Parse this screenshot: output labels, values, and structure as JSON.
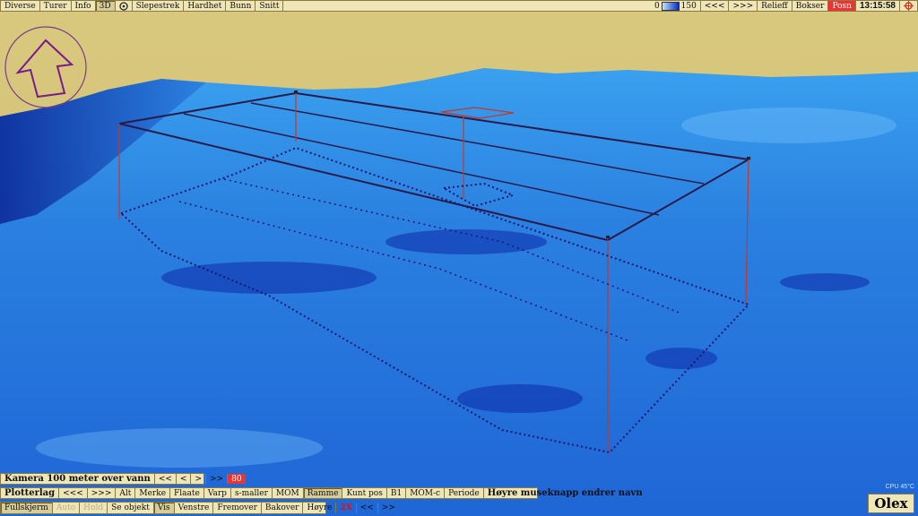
{
  "top_menu": {
    "left": [
      "Diverse",
      "Turer",
      "Info",
      "3D",
      "Slepestrek",
      "Hardhet",
      "Bunn",
      "Snitt"
    ],
    "depth_scale": {
      "min": "0",
      "max": "150"
    },
    "right": [
      "<<<",
      ">>>",
      "Relieff",
      "Bokser",
      "Posn"
    ],
    "clock": "13:15:58"
  },
  "camera_bar": {
    "label": "Kamera 100 meter over vann",
    "buttons": [
      "<<",
      "<",
      ">",
      ">>"
    ],
    "value": "80"
  },
  "plotter_bar": {
    "label": "Plotterlag",
    "buttons": [
      "<<<",
      ">>>",
      "Alt",
      "Merke",
      "Flaate",
      "Varp",
      "s-maller",
      "MOM",
      "Ramme",
      "Kunt pos",
      "B1",
      "MOM-c",
      "Periode"
    ],
    "hint": "Høyre museknapp endrer navn"
  },
  "nav_bar": {
    "buttons": [
      "Fullskjerm",
      "Auto",
      "Hold",
      "Se objekt",
      "Vis",
      "Venstre",
      "Fremover",
      "Bakover",
      "Høyre"
    ],
    "speed": "2X",
    "arrows": [
      "<<",
      ">>"
    ]
  },
  "cpu_temp": "CPU 45°C",
  "logo": "Olex",
  "colors": {
    "sky": "#d4c27a",
    "seafloor_light": "#2f8fe8",
    "seafloor_dark": "#0f2fb0",
    "frame_line": "#2a1a4a",
    "pole_line": "#c0392b"
  }
}
